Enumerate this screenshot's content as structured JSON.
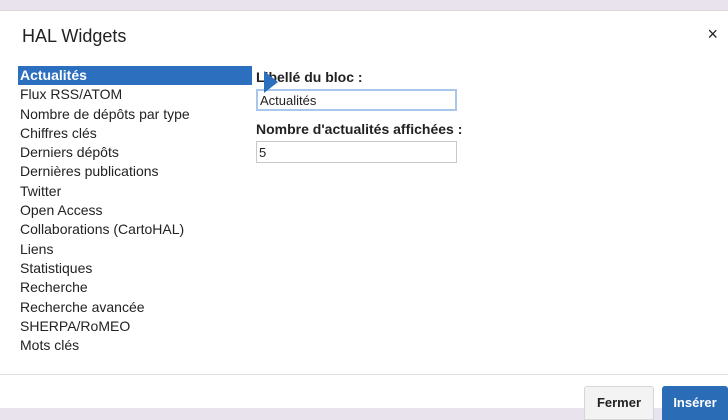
{
  "modal": {
    "title": "HAL Widgets",
    "close_icon": "×"
  },
  "widget_list": {
    "selected_index": 0,
    "items": [
      "Actualités",
      "Flux RSS/ATOM",
      "Nombre de dépôts par type",
      "Chiffres clés",
      "Derniers dépôts",
      "Dernières publications",
      "Twitter",
      "Open Access",
      "Collaborations (CartoHAL)",
      "Liens",
      "Statistiques",
      "Recherche",
      "Recherche avancée",
      "SHERPA/RoMEO",
      "Mots clés"
    ]
  },
  "form": {
    "block_label_label": "Libellé du bloc :",
    "block_label_value": "Actualités",
    "news_count_label": "Nombre d'actualités affichées :",
    "news_count_value": "5"
  },
  "footer": {
    "close_label": "Fermer",
    "insert_label": "Insérer"
  },
  "colors": {
    "accent": "#2c6fbf",
    "insert_button": "#2a6db6",
    "backdrop": "#e8e3ec"
  },
  "icons": {
    "close": "close-icon",
    "pointer": "pointer-arrow-icon"
  }
}
